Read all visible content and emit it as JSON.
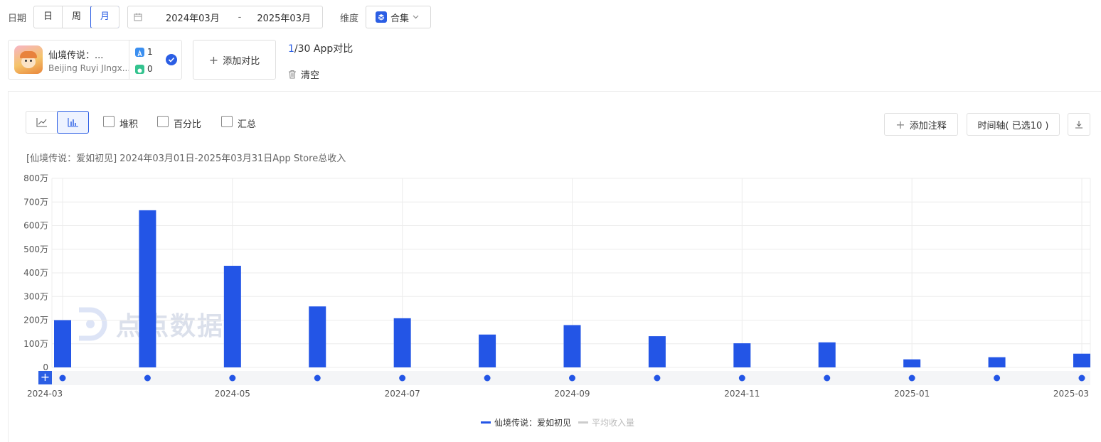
{
  "filters": {
    "date_label": "日期",
    "granularity": [
      "日",
      "周",
      "月"
    ],
    "granularity_active": "月",
    "date_start": "2024年03月",
    "date_sep": "-",
    "date_end": "2025年03月",
    "dimension_label": "维度",
    "dimension_value": "合集"
  },
  "app_card": {
    "name": "仙境传说：...",
    "publisher": "Beijing Ruyi JIngx...",
    "ios_count": "1",
    "android_count": "0"
  },
  "add_compare_label": "添加对比",
  "compare_count": {
    "current": "1",
    "rest": "/30 App对比"
  },
  "clear_label": "清空",
  "toolbar": {
    "stack_label": "堆积",
    "percent_label": "百分比",
    "summary_label": "汇总",
    "add_note_label": "添加注释",
    "timeline_label": "时间轴( 已选10 )"
  },
  "chart_subtitle": "[仙境传说：爱如初见] 2024年03月01日-2025年03月31日App Store总收入",
  "watermark": "点点数据",
  "legend": {
    "series": "仙境传说：爱如初见",
    "avg": "平均收入量"
  },
  "colors": {
    "accent": "#2b5ee4",
    "bar": "#2355e6"
  },
  "chart_data": {
    "type": "bar",
    "categories": [
      "2024-03",
      "2024-04",
      "2024-05",
      "2024-06",
      "2024-07",
      "2024-08",
      "2024-09",
      "2024-10",
      "2024-11",
      "2024-12",
      "2025-01",
      "2025-02",
      "2025-03"
    ],
    "series": [
      {
        "name": "仙境传说：爱如初见",
        "values": [
          2000000,
          6650000,
          4300000,
          2580000,
          2080000,
          1390000,
          1790000,
          1320000,
          1020000,
          1060000,
          340000,
          430000,
          580000
        ]
      }
    ],
    "x_tick_labels": [
      "2024-03",
      "2024-05",
      "2024-07",
      "2024-09",
      "2024-11",
      "2025-01",
      "2025-03"
    ],
    "y_tick_labels": [
      "0",
      "100万",
      "200万",
      "300万",
      "400万",
      "500万",
      "600万",
      "700万",
      "800万"
    ],
    "ylim": [
      0,
      8000000
    ],
    "grid": true
  }
}
